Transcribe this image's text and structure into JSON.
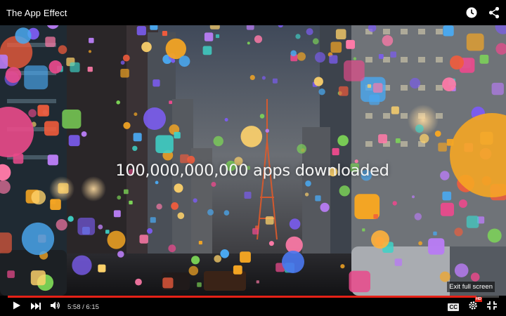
{
  "player": {
    "title": "The App Effect",
    "caption": "100,000,000,000 apps downloaded",
    "exit_fullscreen_label": "Exit full screen",
    "time": "5:58 / 6:15",
    "progress": 0.954,
    "progress_color": "#e52117",
    "cc_label": "CC",
    "hd_badge": "HD"
  },
  "icons": {
    "watch_later": "clock-icon",
    "share": "share-icon",
    "play": "play-icon",
    "next": "next-icon",
    "volume": "volume-icon",
    "captions": "captions-icon",
    "settings": "gear-icon",
    "fullscreen_exit": "exit-fullscreen-icon"
  }
}
